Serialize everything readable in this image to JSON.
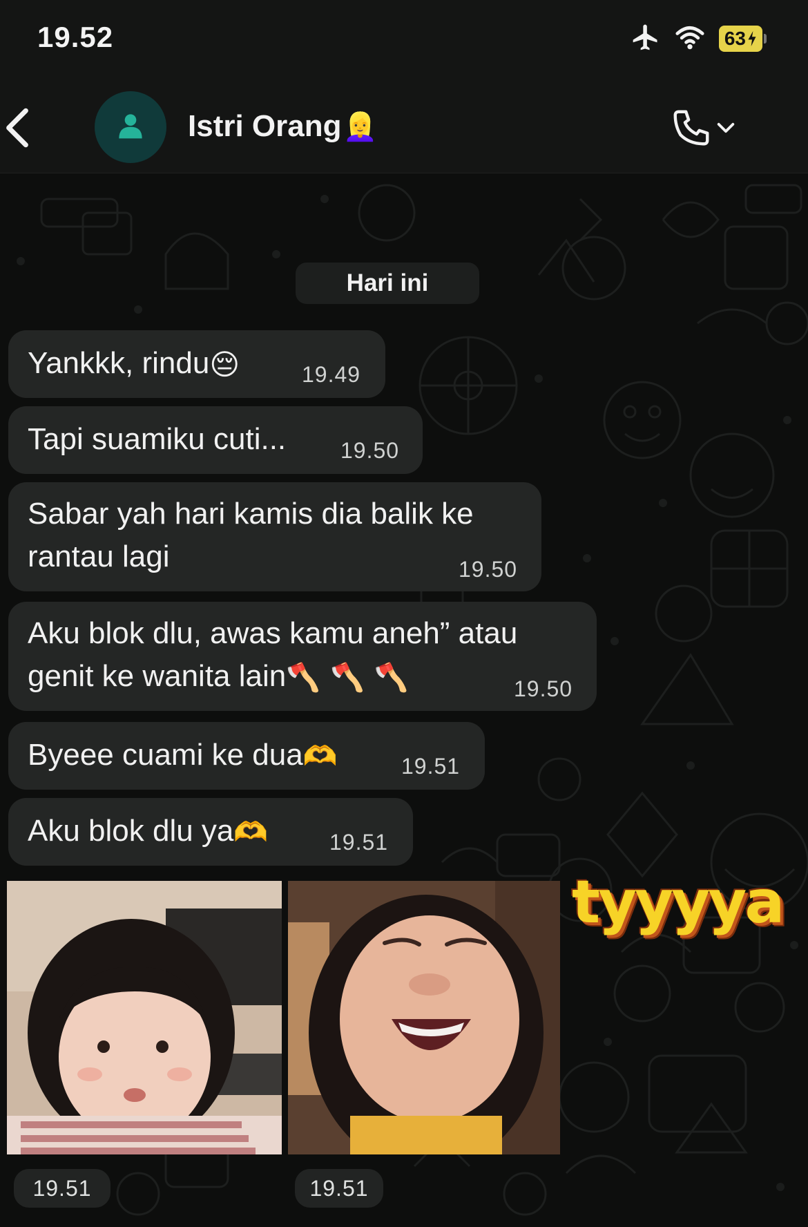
{
  "status_bar": {
    "time": "19.52",
    "battery_level": "63",
    "icons": [
      "airplane-icon",
      "wifi-icon",
      "battery-charging-icon"
    ]
  },
  "header": {
    "contact_name": "Istri Orang",
    "contact_emoji": "👱‍♀️",
    "icons": [
      "back-chevron-icon",
      "person-avatar-icon",
      "phone-icon",
      "chevron-down-icon"
    ]
  },
  "date_divider": "Hari ini",
  "messages": [
    {
      "text": "Yankkk, rindu",
      "emoji": "😔",
      "time": "19.49"
    },
    {
      "text": "Tapi suamiku cuti...",
      "time": "19.50"
    },
    {
      "line1": "Sabar yah hari kamis dia balik ke",
      "line2": "rantau lagi",
      "time": "19.50"
    },
    {
      "line1": "Aku blok dlu, awas kamu aneh” atau",
      "line2": "genit ke wanita lain",
      "emoji": "🪓🪓🪓",
      "time": "19.50"
    },
    {
      "text": "Byeee cuami ke dua",
      "emoji": "🫶",
      "time": "19.51"
    },
    {
      "text": "Aku blok dlu ya",
      "emoji": "🫶",
      "time": "19.51"
    }
  ],
  "photos": [
    {
      "time": "19.51"
    },
    {
      "time": "19.51"
    }
  ],
  "overlay_caption": "tyyyya",
  "colors": {
    "background": "#0d0e0d",
    "bubble": "#242625",
    "header": "#141514",
    "avatar": "#103a3a",
    "avatar_icon": "#25b39a",
    "battery": "#e6d34a",
    "caption": "#f7d327"
  }
}
